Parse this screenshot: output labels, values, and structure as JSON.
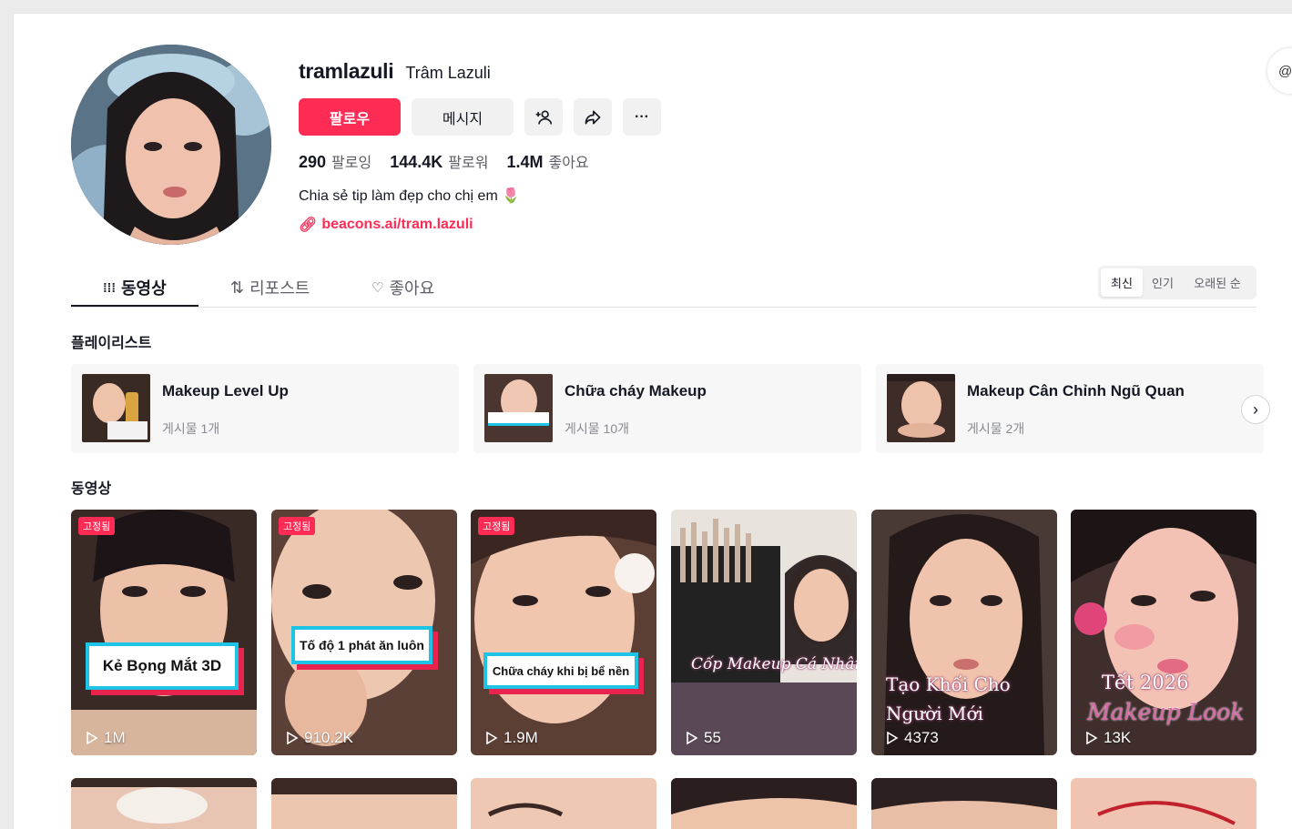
{
  "profile": {
    "username": "tramlazuli",
    "nickname": "Trâm Lazuli",
    "follow_label": "팔로우",
    "message_label": "메시지",
    "more_label": "···",
    "stats": [
      {
        "value": "290",
        "label": "팔로잉"
      },
      {
        "value": "144.4K",
        "label": "팔로워"
      },
      {
        "value": "1.4M",
        "label": "좋아요"
      }
    ],
    "bio": "Chia sẻ tip làm đẹp cho chị em 🌷",
    "link": "beacons.ai/tram.lazuli"
  },
  "tabs": [
    {
      "label": "동영상",
      "icon": "grid-icon"
    },
    {
      "label": "리포스트",
      "icon": "repost-icon"
    },
    {
      "label": "좋아요",
      "icon": "heart-icon"
    }
  ],
  "sort": [
    "최신",
    "인기",
    "오래된 순"
  ],
  "playlist_section": "플레이리스트",
  "playlists": [
    {
      "title": "Makeup Level Up",
      "count": "게시물 1개"
    },
    {
      "title": "Chữa cháy Makeup",
      "count": "게시물 10개"
    },
    {
      "title": "Makeup Cân Chỉnh Ngũ Quan",
      "count": "게시물 2개"
    }
  ],
  "videos_section": "동영상",
  "videos": [
    {
      "pinned": "고정됨",
      "caption": "Kẻ Bọng Mắt 3D",
      "views": "1M"
    },
    {
      "pinned": "고정됨",
      "caption": "Tố độ 1 phát ăn luôn",
      "views": "910.2K"
    },
    {
      "pinned": "고정됨",
      "caption": "Chữa cháy khi bị bể nền",
      "views": "1.9M"
    },
    {
      "caption": "Cốp Makeup Cá Nhân",
      "views": "55"
    },
    {
      "caption_line1": "Tạo Khối Cho",
      "caption_line2": "Người Mới",
      "views": "4373"
    },
    {
      "caption_line1": "Tết 2026",
      "caption_line2": "Makeup Look",
      "views": "13K"
    }
  ],
  "colors": {
    "accent": "#fe2c55",
    "caption_border": "#1ec4e6",
    "caption_shadow": "#e8234d"
  }
}
